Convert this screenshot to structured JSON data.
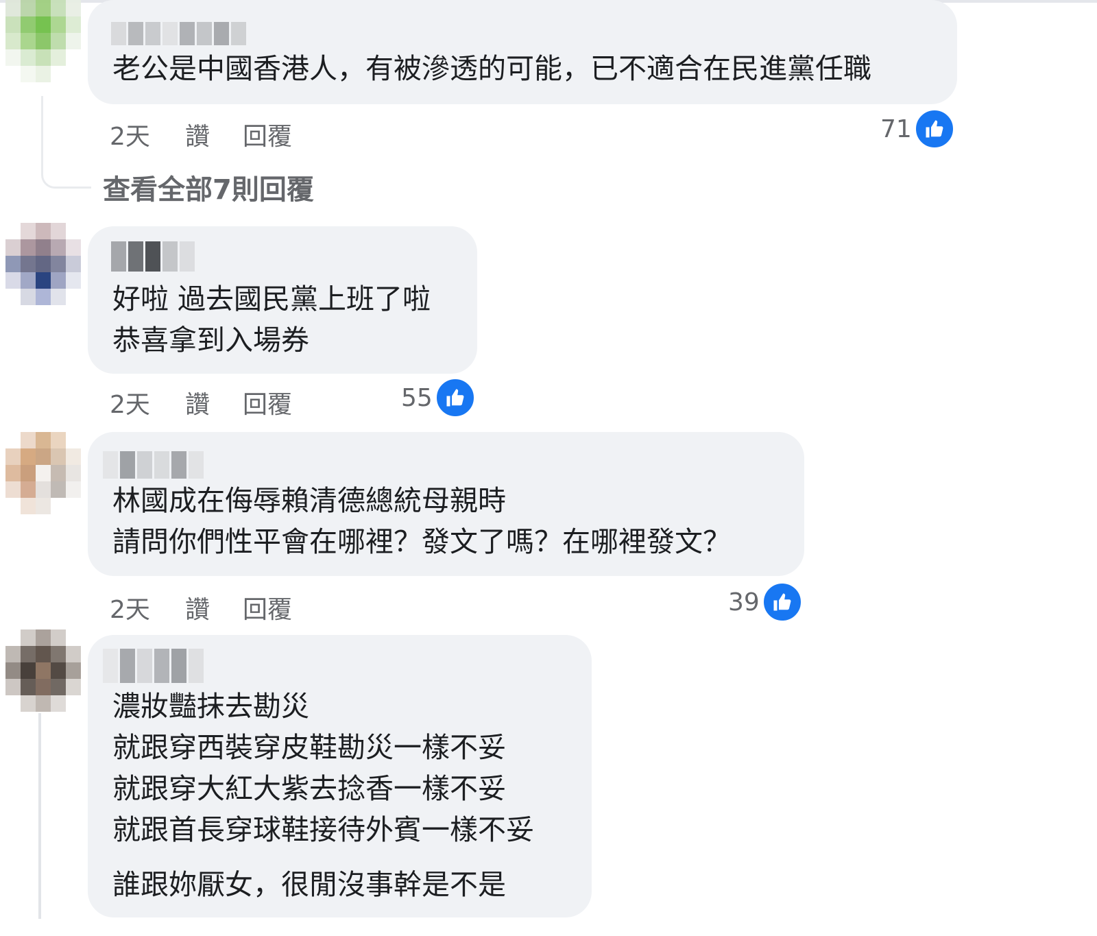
{
  "accent_color": "#1877f2",
  "bubble_color": "#f0f2f5",
  "meta_color": "#65676b",
  "comments": [
    {
      "lines": [
        "老公是中國香港人，有被滲透的可能，已不適合在民進黨任職"
      ],
      "time": "2天",
      "like_label": "讚",
      "reply_label": "回覆",
      "reaction_count": "71",
      "reaction_icon": "like-icon"
    },
    {
      "lines": [
        "好啦 過去國民黨上班了啦",
        "恭喜拿到入場券"
      ],
      "time": "2天",
      "like_label": "讚",
      "reply_label": "回覆",
      "reaction_count": "55",
      "reaction_icon": "like-icon"
    },
    {
      "lines": [
        "林國成在侮辱賴清德總統母親時",
        "請問你們性平會在哪裡？發文了嗎？在哪裡發文？"
      ],
      "time": "2天",
      "like_label": "讚",
      "reply_label": "回覆",
      "reaction_count": "39",
      "reaction_icon": "like-icon"
    },
    {
      "lines": [
        "濃妝豔抹去勘災",
        "就跟穿西裝穿皮鞋勘災一樣不妥",
        "就跟穿大紅大紫去捻香一樣不妥",
        "就跟首長穿球鞋接待外賓一樣不妥",
        "誰跟妳厭女，很閒沒事幹是不是"
      ]
    }
  ],
  "view_all_replies": "查看全部7則回覆"
}
